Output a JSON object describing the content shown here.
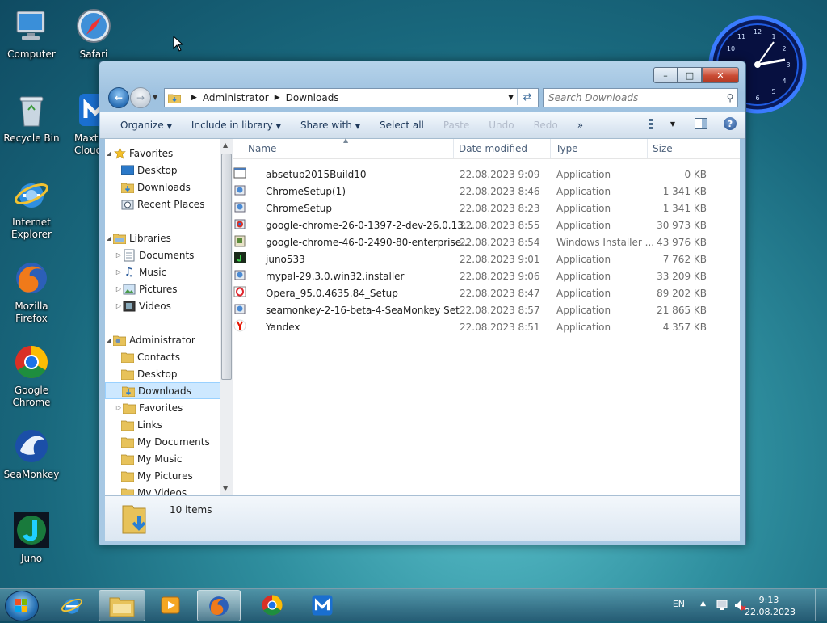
{
  "desktop": {
    "icons": [
      {
        "label": "Computer"
      },
      {
        "label": "Safari"
      },
      {
        "label": "Recycle Bin"
      },
      {
        "label": "Maxthon Cloud"
      },
      {
        "label": "Internet Explorer"
      },
      {
        "label": "Mozilla Firefox"
      },
      {
        "label": "Google Chrome"
      },
      {
        "label": "SeaMonkey"
      },
      {
        "label": "Juno"
      }
    ]
  },
  "window": {
    "caption_buttons": {
      "minimize": "–",
      "maximize": "□",
      "close": "✕"
    },
    "breadcrumb": [
      "Administrator",
      "Downloads"
    ],
    "search_placeholder": "Search Downloads",
    "toolbar": {
      "organize": "Organize",
      "include": "Include in library",
      "share": "Share with",
      "select_all": "Select all",
      "paste": "Paste",
      "undo": "Undo",
      "redo": "Redo",
      "more": "»"
    },
    "nav": {
      "favorites": "Favorites",
      "desktop": "Desktop",
      "downloads": "Downloads",
      "recent": "Recent Places",
      "libraries": "Libraries",
      "documents": "Documents",
      "music": "Music",
      "pictures": "Pictures",
      "videos": "Videos",
      "administrator": "Administrator",
      "contacts": "Contacts",
      "desktop2": "Desktop",
      "downloads2": "Downloads",
      "favorites2": "Favorites",
      "links": "Links",
      "mydocuments": "My Documents",
      "mymusic": "My Music",
      "mypictures": "My Pictures",
      "myvideos": "My Videos"
    },
    "columns": {
      "name": "Name",
      "date": "Date modified",
      "type": "Type",
      "size": "Size"
    },
    "files": [
      {
        "name": "absetup2015Build10",
        "date": "22.08.2023 9:09",
        "type": "Application",
        "size": "0 KB"
      },
      {
        "name": "ChromeSetup(1)",
        "date": "22.08.2023 8:46",
        "type": "Application",
        "size": "1 341 KB"
      },
      {
        "name": "ChromeSetup",
        "date": "22.08.2023 8:23",
        "type": "Application",
        "size": "1 341 KB"
      },
      {
        "name": "google-chrome-26-0-1397-2-dev-26.0.13...",
        "date": "22.08.2023 8:55",
        "type": "Application",
        "size": "30 973 KB"
      },
      {
        "name": "google-chrome-46-0-2490-80-enterprise...",
        "date": "22.08.2023 8:54",
        "type": "Windows Installer ...",
        "size": "43 976 KB"
      },
      {
        "name": "juno533",
        "date": "22.08.2023 9:01",
        "type": "Application",
        "size": "7 762 KB"
      },
      {
        "name": "mypal-29.3.0.win32.installer",
        "date": "22.08.2023 9:06",
        "type": "Application",
        "size": "33 209 KB"
      },
      {
        "name": "Opera_95.0.4635.84_Setup",
        "date": "22.08.2023 8:47",
        "type": "Application",
        "size": "89 202 KB"
      },
      {
        "name": "seamonkey-2-16-beta-4-SeaMonkey Set...",
        "date": "22.08.2023 8:57",
        "type": "Application",
        "size": "21 865 KB"
      },
      {
        "name": "Yandex",
        "date": "22.08.2023 8:51",
        "type": "Application",
        "size": "4 357 KB"
      }
    ],
    "item_count": "10 items"
  },
  "taskbar": {
    "lang": "EN",
    "time": "9:13",
    "date": "22.08.2023"
  },
  "colors": {
    "selection": "#cde8ff",
    "window_frame": "#a8c9e4",
    "link_text": "#1e395b"
  }
}
